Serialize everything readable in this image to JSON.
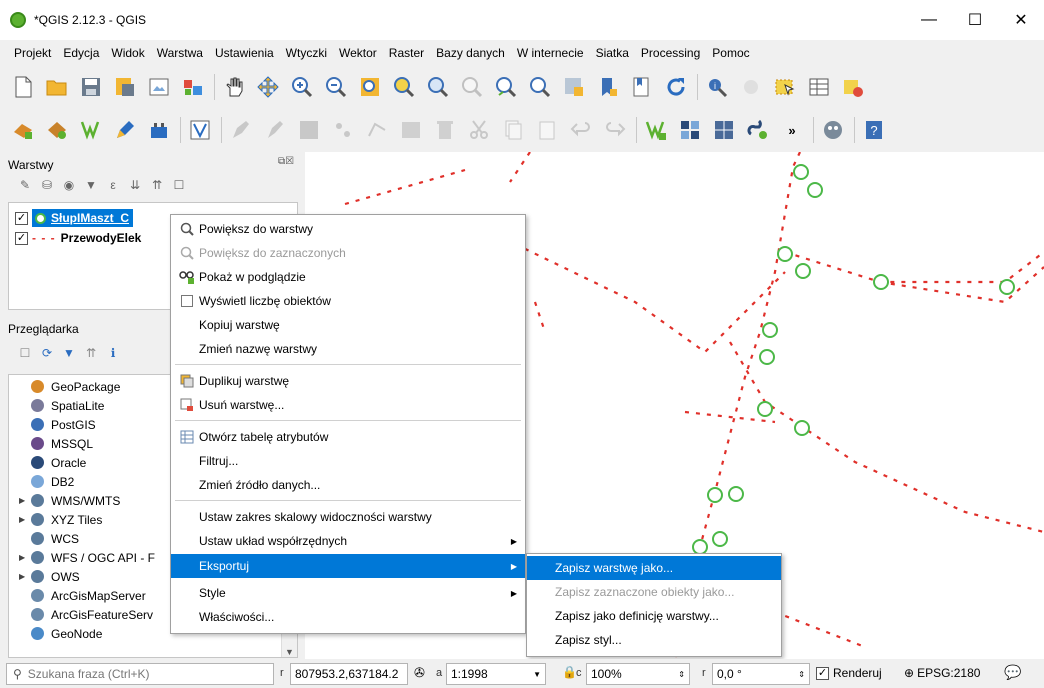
{
  "window": {
    "title": "*QGIS 2.12.3 - QGIS",
    "minimize": "—",
    "maximize": "☐",
    "close": "✕"
  },
  "menubar": [
    "Projekt",
    "Edycja",
    "Widok",
    "Warstwa",
    "Ustawienia",
    "Wtyczki",
    "Wektor",
    "Raster",
    "Bazy danych",
    "W internecie",
    "Siatka",
    "Processing",
    "Pomoc"
  ],
  "layers_panel": {
    "title": "Warstwy",
    "layers": [
      {
        "name": "SłupIMaszt_C",
        "checked": true
      },
      {
        "name": "PrzewodyElek",
        "checked": true
      }
    ]
  },
  "browser_panel": {
    "title": "Przeglądarka",
    "items": [
      {
        "label": "GeoPackage",
        "icon": "geopackage-icon",
        "expandable": false
      },
      {
        "label": "SpatiaLite",
        "icon": "spatialite-icon",
        "expandable": false
      },
      {
        "label": "PostGIS",
        "icon": "postgis-icon",
        "expandable": false
      },
      {
        "label": "MSSQL",
        "icon": "mssql-icon",
        "expandable": false
      },
      {
        "label": "Oracle",
        "icon": "oracle-icon",
        "expandable": false
      },
      {
        "label": "DB2",
        "icon": "db2-icon",
        "expandable": false
      },
      {
        "label": "WMS/WMTS",
        "icon": "wms-icon",
        "expandable": true
      },
      {
        "label": "XYZ Tiles",
        "icon": "xyz-icon",
        "expandable": true
      },
      {
        "label": "WCS",
        "icon": "wcs-icon",
        "expandable": false
      },
      {
        "label": "WFS / OGC API - F",
        "icon": "wfs-icon",
        "expandable": true
      },
      {
        "label": "OWS",
        "icon": "ows-icon",
        "expandable": true
      },
      {
        "label": "ArcGisMapServer",
        "icon": "arcgis-icon",
        "expandable": false
      },
      {
        "label": "ArcGisFeatureServ",
        "icon": "arcgis-feature-icon",
        "expandable": false
      },
      {
        "label": "GeoNode",
        "icon": "geonode-icon",
        "expandable": false
      }
    ]
  },
  "context_menu": {
    "items": [
      {
        "label": "Powiększ do warstwy",
        "icon": "zoom-icon",
        "disabled": false
      },
      {
        "label": "Powiększ do zaznaczonych",
        "icon": "zoom-icon",
        "disabled": true
      },
      {
        "label": "Pokaż w podglądzie",
        "icon": "overview-icon",
        "disabled": false
      },
      {
        "label": "Wyświetl liczbę obiektów",
        "icon": "checkbox-icon",
        "disabled": false
      },
      {
        "label": "Kopiuj warstwę",
        "icon": "",
        "disabled": false
      },
      {
        "label": "Zmień nazwę warstwy",
        "icon": "",
        "disabled": false
      },
      {
        "label": "Duplikuj warstwę",
        "icon": "duplicate-icon",
        "disabled": false
      },
      {
        "label": "Usuń warstwę...",
        "icon": "remove-icon",
        "disabled": false
      },
      {
        "label": "Otwórz tabelę atrybutów",
        "icon": "table-icon",
        "disabled": false
      },
      {
        "label": "Filtruj...",
        "icon": "",
        "disabled": false
      },
      {
        "label": "Zmień źródło danych...",
        "icon": "",
        "disabled": false
      },
      {
        "label": "Ustaw zakres skalowy widoczności warstwy",
        "icon": "",
        "disabled": false
      },
      {
        "label": "Ustaw układ współrzędnych",
        "icon": "",
        "disabled": false,
        "submenu": true
      },
      {
        "label": "Eksportuj",
        "icon": "",
        "disabled": false,
        "submenu": true,
        "highlighted": true
      },
      {
        "label": "Style",
        "icon": "",
        "disabled": false,
        "submenu": true
      },
      {
        "label": "Właściwości...",
        "icon": "",
        "disabled": false
      }
    ]
  },
  "export_submenu": {
    "items": [
      {
        "label": "Zapisz warstwę jako...",
        "highlighted": true,
        "disabled": false
      },
      {
        "label": "Zapisz zaznaczone obiekty jako...",
        "highlighted": false,
        "disabled": true
      },
      {
        "label": "Zapisz jako definicję warstwy...",
        "highlighted": false,
        "disabled": false
      },
      {
        "label": "Zapisz styl...",
        "highlighted": false,
        "disabled": false
      }
    ]
  },
  "statusbar": {
    "search_placeholder": "Szukana fraza (Ctrl+K)",
    "coord_label": "r",
    "coordinates": "807953.2,637184.2",
    "scale_label": "a",
    "scale": "1:1998",
    "magnifier_label": "c",
    "magnifier": "100%",
    "rotation_label": "r",
    "rotation": "0,0 °",
    "render_label": "Renderuj",
    "render_checked": true,
    "crs": "EPSG:2180"
  },
  "colors": {
    "accent": "#0078d7",
    "line": "#e0302a",
    "point": "#4cb848"
  }
}
